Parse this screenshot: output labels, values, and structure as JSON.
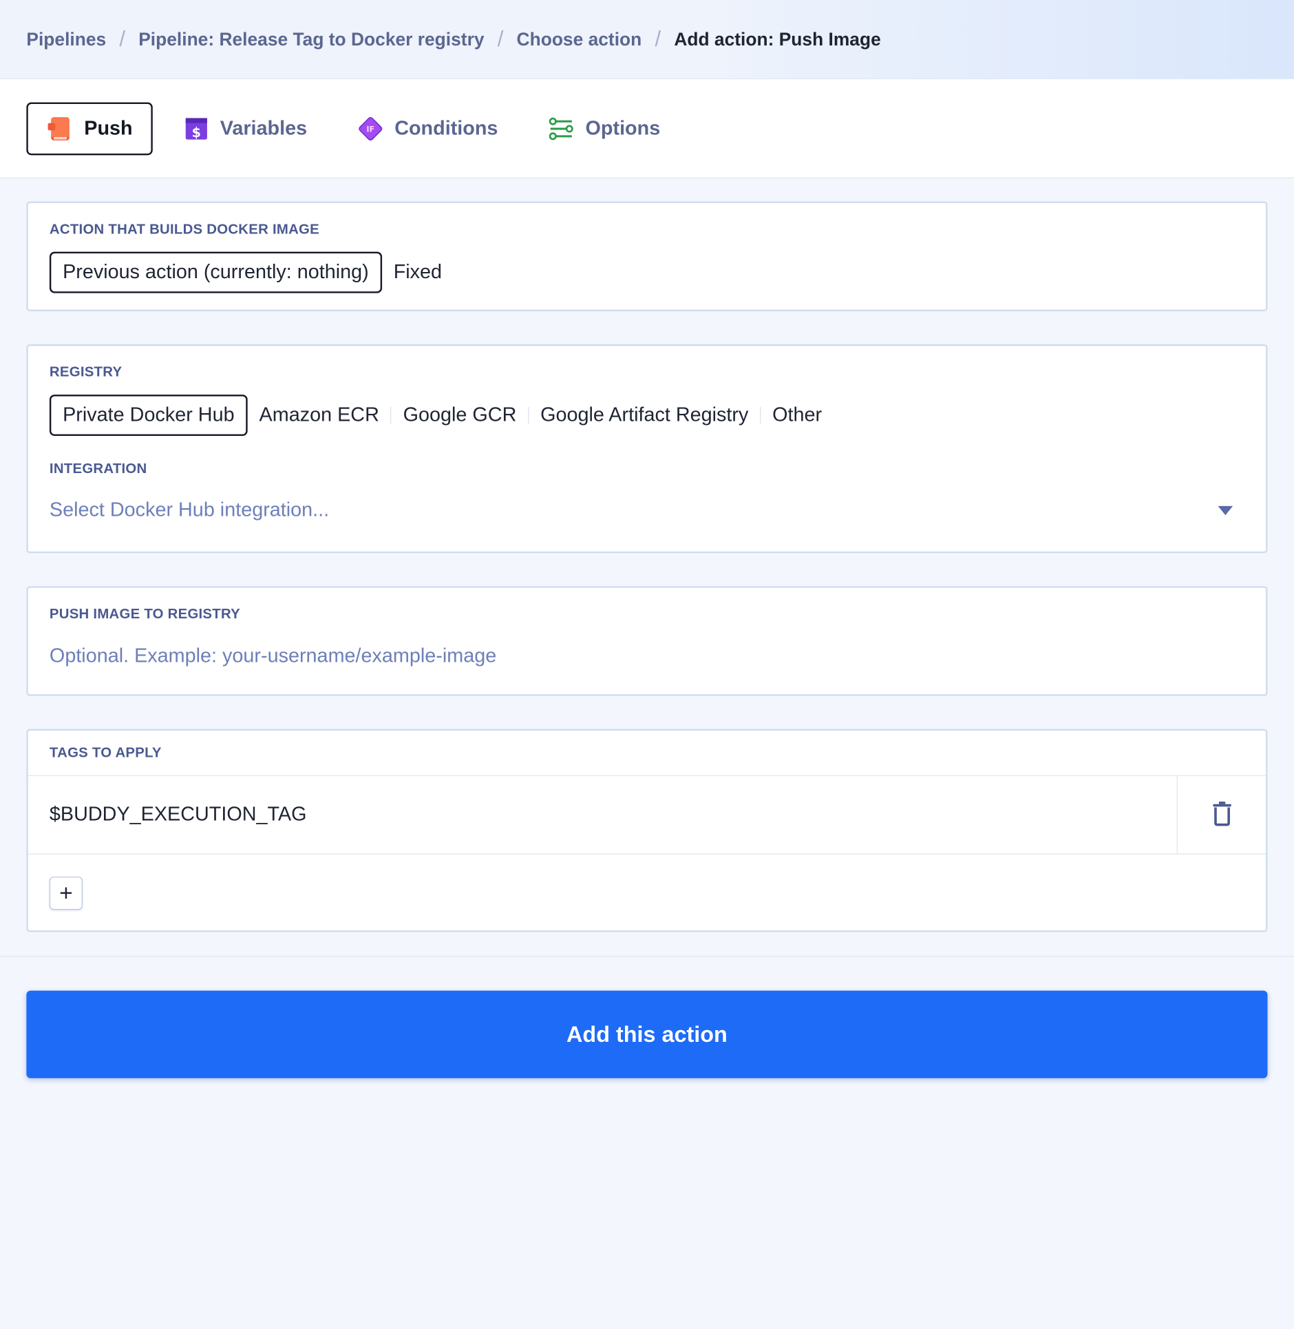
{
  "breadcrumb": {
    "items": [
      {
        "label": "Pipelines"
      },
      {
        "label": "Pipeline: Release Tag to Docker registry"
      },
      {
        "label": "Choose action"
      },
      {
        "label": "Add action: Push Image"
      }
    ],
    "separator": "/"
  },
  "tabs": [
    {
      "label": "Push",
      "icon": "push-icon",
      "active": true
    },
    {
      "label": "Variables",
      "icon": "dollar-icon"
    },
    {
      "label": "Conditions",
      "icon": "if-diamond-icon"
    },
    {
      "label": "Options",
      "icon": "sliders-icon"
    }
  ],
  "builder": {
    "label": "ACTION THAT BUILDS DOCKER IMAGE",
    "options": [
      "Previous action (currently: nothing)",
      "Fixed"
    ],
    "selected": "Previous action (currently: nothing)"
  },
  "registry": {
    "label": "REGISTRY",
    "options": [
      "Private Docker Hub",
      "Amazon ECR",
      "Google GCR",
      "Google Artifact Registry",
      "Other"
    ],
    "selected": "Private Docker Hub",
    "integration_label": "INTEGRATION",
    "integration_placeholder": "Select Docker Hub integration..."
  },
  "push_image": {
    "label": "PUSH IMAGE TO REGISTRY",
    "placeholder": "Optional. Example: your-username/example-image"
  },
  "tags": {
    "label": "TAGS TO APPLY",
    "items": [
      "$BUDDY_EXECUTION_TAG"
    ],
    "add_symbol": "+"
  },
  "footer": {
    "primary_label": "Add this action"
  },
  "colors": {
    "primary": "#1e6bf7",
    "label_text": "#4a5990",
    "muted_text": "#5b6690"
  }
}
